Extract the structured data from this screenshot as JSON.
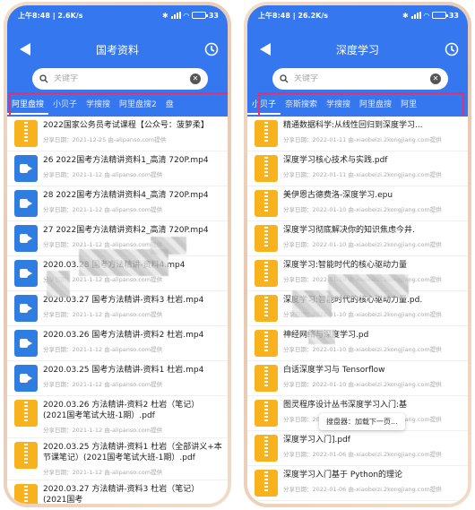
{
  "left": {
    "status": {
      "time": "上午8:48",
      "speed": "2.6K/s",
      "battery": "33",
      "battery_level": 0.33
    },
    "title": "国考资料",
    "search_placeholder": "关键字",
    "tabs": [
      "阿里盘搜",
      "小贝子",
      "学搜搜",
      "阿里盘搜2",
      "盘"
    ],
    "active_tab": 0,
    "items": [
      {
        "type": "zip",
        "title": "2022国家公务员考试课程【公众号：菠萝柔】",
        "meta": "分享日期：2021-12-25   由-alipanso.com提供"
      },
      {
        "type": "video",
        "title": "26 2022国考方法精讲资料1_高清 720P.mp4",
        "meta": "分享日期：2021-1-12   由-alipanso.com提供"
      },
      {
        "type": "video",
        "title": "28 2022国考方法精讲资料4_高清 720P.mp4",
        "meta": "分享日期：2021-1-12   由-alipanso.com提供"
      },
      {
        "type": "video",
        "title": "27 2022国考方法精讲资料2_高清 720P.mp4",
        "meta": "分享日期：2021-1-12   由-alipanso.com提供"
      },
      {
        "type": "video",
        "title": "2020.03.28 国考方法精讲-资料4.mp4",
        "meta": "分享日期：2021-1-12   由-alipanso.com提供"
      },
      {
        "type": "video",
        "title": "2020.03.27 国考方法精讲-资料3 杜岩.mp4",
        "meta": "分享日期：2021-1-12   由-alipanso.com提供"
      },
      {
        "type": "video",
        "title": "2020.03.26 国考方法精讲-资料2 杜岩.mp4",
        "meta": "分享日期：2021-1-12   由-alipanso.com提供"
      },
      {
        "type": "video",
        "title": "2020.03.25 国考方法精讲-资料1 杜岩.mp4",
        "meta": "分享日期：2021-1-12   由-alipanso.com提供"
      },
      {
        "type": "zip",
        "title": "2020.03.26 方法精讲-资料2 杜岩（笔记）(2021国考笔试大班-1期）.pdf",
        "meta": "分享日期：2021-1-12   由-alipanso.com提供"
      },
      {
        "type": "zip",
        "title": "2020.03.25 方法精讲-资料1 杜岩（全部讲义+本节课笔记）(2021国考笔试大班-1期）.pdf",
        "meta": "分享日期：2021-1-12   由-alipanso.com提供"
      },
      {
        "type": "zip",
        "title": "2020.03.27 方法精讲-资料3 杜岩（笔记）(2021国考",
        "meta": ""
      }
    ]
  },
  "right": {
    "status": {
      "time": "上午8:48",
      "speed": "26.2K/s",
      "battery": "33",
      "battery_level": 0.33
    },
    "title": "深度学习",
    "search_placeholder": "关键字",
    "tabs": [
      "小贝子",
      "奈斯搜索",
      "学搜搜",
      "阿里盘搜",
      "阿里"
    ],
    "active_tab": 0,
    "items": [
      {
        "title": "精通数据科学:从线性回归到深度学习...",
        "meta": "分享日期：2022-01-11   由-xiaobeizi.2kongjiang.com提供"
      },
      {
        "title": "深度学习核心技术与实践.pdf",
        "meta": "分享日期：2022-01-11   由-xiaobeizi.2kongjiang.com提供"
      },
      {
        "title": "美伊恩古德费洛-深度学习.epu",
        "meta": "分享日期：2022-01-10   由-xiaobeizi.2kongjiang.com提供"
      },
      {
        "title": "深度学习彻底解决你的知识焦虑今井.",
        "meta": "分享日期：2022-01-10   由-xiaobeizi.2kongjiang.com提供"
      },
      {
        "title": "深度学习:智能时代的核心驱动力量",
        "meta": "分享日期：2022-01-10   由-xiaobeizi.2kongjiang.com提供"
      },
      {
        "title": "深度学习:智能时代的核心驱动力量.pd.",
        "meta": "分享日期：2022-01-10   由-xiaobeizi.2kongjiang.com提供"
      },
      {
        "title": "神经网络与深度学习.pd",
        "meta": "分享日期：2022-01-10   由-xiaobeizi.2kongjiang.com提供"
      },
      {
        "title": "白话深度学习与 Tensorflow",
        "meta": "分享日期：2022-01-10   由-xiaobeizi.2kongjiang.com提供"
      },
      {
        "title": "图灵程序设计丛书深度学习入门:基",
        "meta": "分享日期：2022-01-10   由-xiaobeizi.2kongjiang.com提供"
      },
      {
        "title": "深度学习入门].pdf",
        "meta": "分享日期：2022-01-06   由-xiaobeizi.2kongjiang.com提供"
      },
      {
        "title": "深度学习入门基于 Python的理论",
        "meta": "分享日期：2022-01-06   由-xiaobeizi.2kongjiang.com提供"
      }
    ],
    "toast": "搜盘器：加载下一页..."
  },
  "colors": {
    "header": "#3477ee",
    "highlight": "#e0326f",
    "zip": "#f8b21d",
    "video": "#2f7de1"
  }
}
